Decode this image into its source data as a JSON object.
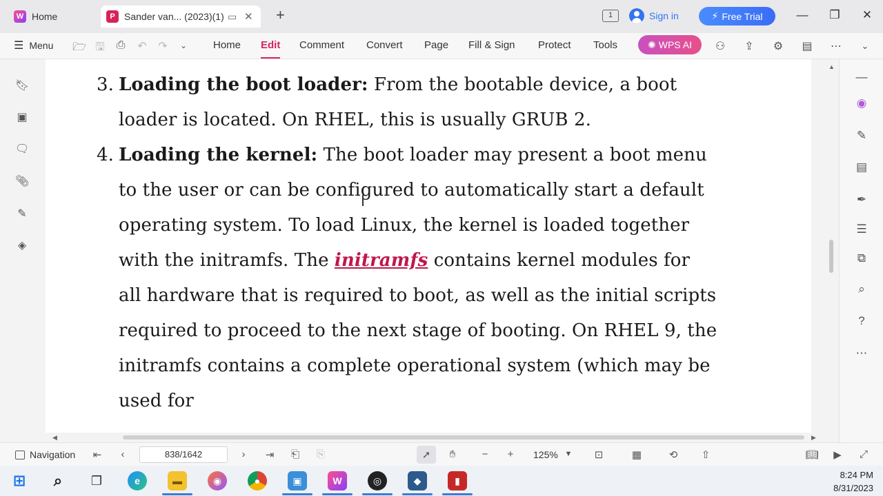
{
  "titlebar": {
    "home_tab": "Home",
    "doc_tab": "Sander van... (2023)(1)",
    "pages_badge": "1",
    "sign_in": "Sign in",
    "free_trial": "Free Trial",
    "icons": [
      "wps-logo-icon",
      "pdf-logo-icon",
      "restore-tab-icon",
      "close-tab-icon",
      "new-tab-icon",
      "minimize-icon",
      "maximize-icon",
      "close-window-icon"
    ]
  },
  "toolbar": {
    "menu": "Menu",
    "tabs": [
      "Home",
      "Edit",
      "Comment",
      "Convert",
      "Page",
      "Fill & Sign",
      "Protect",
      "Tools"
    ],
    "active_tab": "Edit",
    "wps_ai": "WPS AI",
    "accent": "#d6245a"
  },
  "document": {
    "item3": {
      "number": "3.",
      "heading": "Loading the boot loader:",
      "text": " From the bootable device, a boot loader is located. On RHEL, this is usually GRUB 2."
    },
    "item4": {
      "number": "4.",
      "heading": "Loading the kernel:",
      "text_before": " The boot loader may present a boot menu to the user or can be configured to automatically start a default operating system. To load Linux, the kernel is loaded together with the initramfs. The ",
      "link": "initramfs",
      "text_after": " contains kernel modules for all hardware that is required to boot, as well as the initial scripts required to proceed to the next stage of booting. On RHEL 9, the initramfs contains a complete operational system (which may be used for"
    }
  },
  "statusbar": {
    "navigation": "Navigation",
    "page": "838/1642",
    "zoom": "125%"
  },
  "taskbar": {
    "time": "8:24 PM",
    "date": "8/31/2023"
  }
}
